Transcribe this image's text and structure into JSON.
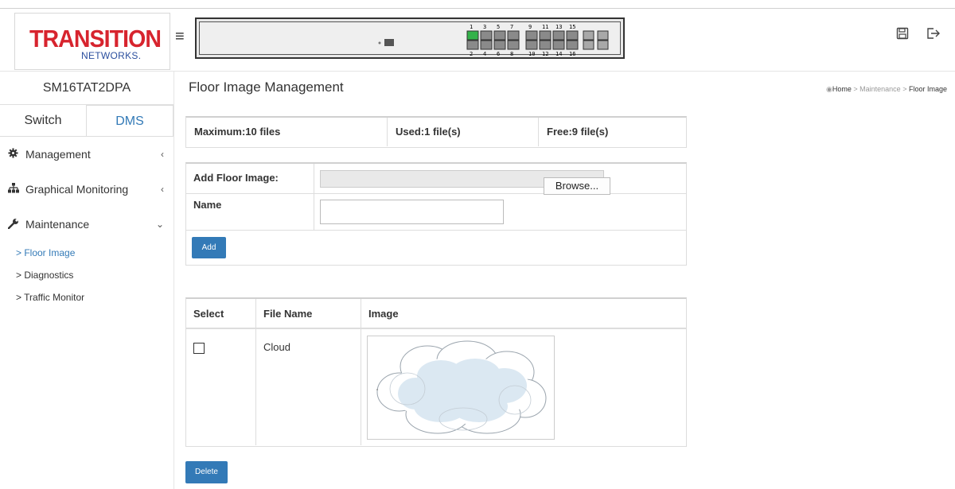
{
  "header": {
    "logo_main": "TRANSITION",
    "logo_sub": "NETWORKS.",
    "port_labels_top": [
      "1",
      "3",
      "5",
      "7",
      "9",
      "11",
      "13",
      "15"
    ],
    "port_labels_bottom": [
      "2",
      "4",
      "6",
      "8",
      "10",
      "12",
      "14",
      "16"
    ],
    "icons": [
      "save-icon",
      "logout-icon"
    ]
  },
  "sidebar": {
    "device_name": "SM16TAT2DPA",
    "tabs": [
      {
        "label": "Switch"
      },
      {
        "label": "DMS"
      }
    ],
    "items": [
      {
        "label": "Management",
        "icon": "gear-icon",
        "caret": "‹"
      },
      {
        "label": "Graphical Monitoring",
        "icon": "sitemap-icon",
        "caret": "‹"
      },
      {
        "label": "Maintenance",
        "icon": "wrench-icon",
        "caret": "⌄"
      }
    ],
    "sub_items": [
      {
        "label": "> Floor Image"
      },
      {
        "label": "> Diagnostics"
      },
      {
        "label": "> Traffic Monitor"
      }
    ]
  },
  "main": {
    "title": "Floor Image Management",
    "breadcrumb": {
      "home": "Home",
      "sep1": " > ",
      "maintenance": "Maintenance",
      "sep2": " > ",
      "current": "Floor Image"
    },
    "summary": {
      "maximum": "Maximum:10 files",
      "used": "Used:1 file(s)",
      "free": "Free:9 file(s)"
    },
    "form": {
      "add_label": "Add Floor Image:",
      "browse_label": "Browse...",
      "name_label": "Name",
      "name_value": "",
      "add_button": "Add"
    },
    "table": {
      "headers": [
        "Select",
        "File Name",
        "Image"
      ],
      "rows": [
        {
          "file_name": "Cloud",
          "selected": false
        }
      ]
    },
    "delete_button": "Delete"
  },
  "colors": {
    "accent": "#337ab7",
    "brand_red": "#d7242e",
    "brand_blue": "#2b4f9e",
    "port_up": "#34b24a"
  }
}
